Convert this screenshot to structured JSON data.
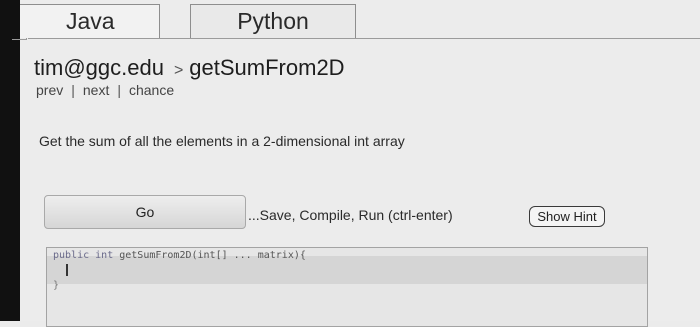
{
  "tabs": [
    {
      "label": "Java",
      "active": true
    },
    {
      "label": "Python",
      "active": false
    }
  ],
  "breadcrumb": {
    "user": "tim@ggc.edu",
    "separator": ">",
    "problem": "getSumFrom2D"
  },
  "nav": {
    "prev": "prev",
    "next": "next",
    "chance": "chance",
    "divider": "|"
  },
  "description": "Get the sum of all the elements in a 2-dimensional int array",
  "actions": {
    "go_label": "Go",
    "save_text": "...Save, Compile, Run (ctrl-enter)",
    "hint_label": "Show Hint"
  },
  "editor": {
    "keyword_1": "public",
    "keyword_2": "int",
    "signature_rest": "getSumFrom2D(int[] ... matrix){",
    "line_3": "}"
  },
  "colors": {
    "page_background": "#ececec",
    "editor_background": "#e6e6e6",
    "active_line": "#d5d5d5"
  }
}
